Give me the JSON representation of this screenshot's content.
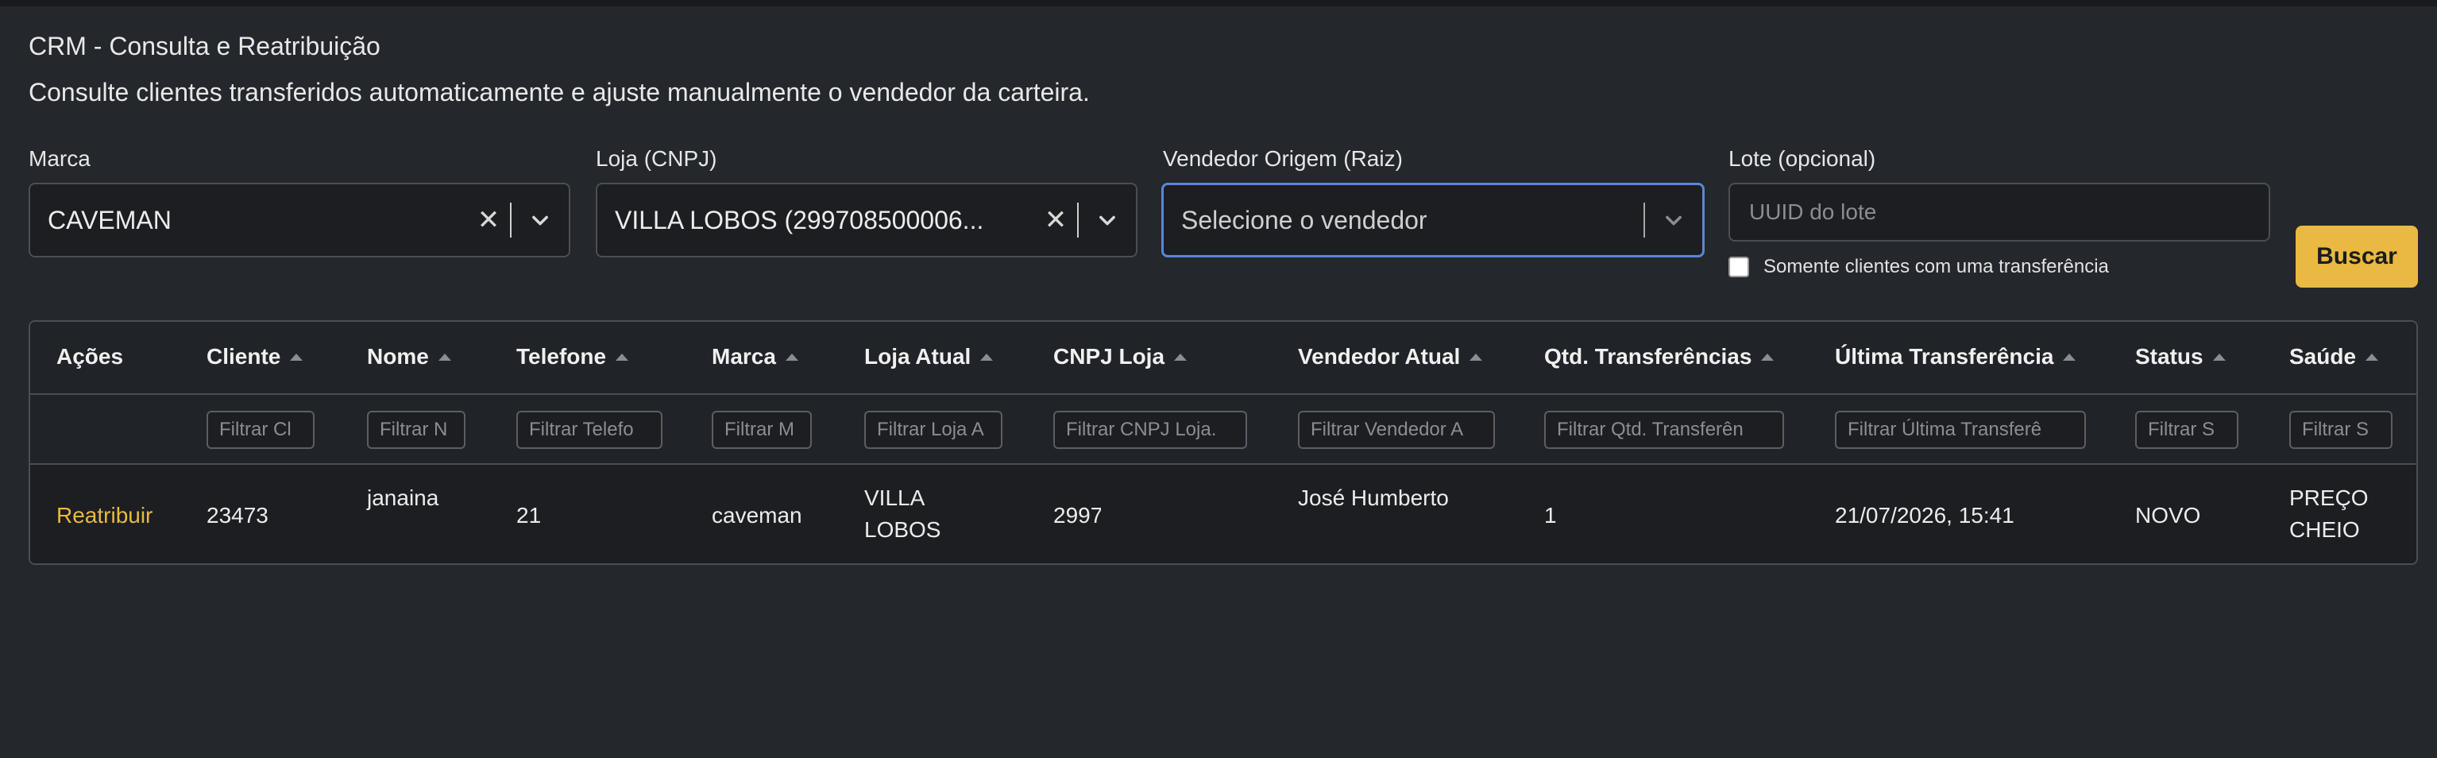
{
  "page": {
    "title": "CRM - Consulta e Reatribuição",
    "subtitle": "Consulte clientes transferidos automaticamente e ajuste manualmente o vendedor da carteira."
  },
  "filters": {
    "marca": {
      "label": "Marca",
      "value": "CAVEMAN"
    },
    "loja": {
      "label": "Loja (CNPJ)",
      "value": "VILLA LOBOS (299708500006..."
    },
    "vendedor": {
      "label": "Vendedor Origem (Raiz)",
      "placeholder": "Selecione o vendedor"
    },
    "lote": {
      "label": "Lote (opcional)",
      "placeholder": "UUID do lote"
    },
    "somente_uma": {
      "label": "Somente clientes com uma transferência",
      "checked": false
    },
    "buscar_label": "Buscar"
  },
  "table": {
    "headers": {
      "acoes": "Ações",
      "cliente": "Cliente",
      "nome": "Nome",
      "telefone": "Telefone",
      "marca": "Marca",
      "loja_atual": "Loja Atual",
      "cnpj_loja": "CNPJ Loja",
      "vendedor_atual": "Vendedor Atual",
      "qtd_transferencias": "Qtd. Transferências",
      "ultima_transferencia": "Última Transferência",
      "status": "Status",
      "saude": "Saúde"
    },
    "filter_placeholders": {
      "cliente": "Filtrar Cl",
      "nome": "Filtrar N",
      "telefone": "Filtrar Telefo",
      "marca": "Filtrar M",
      "loja_atual": "Filtrar Loja A",
      "cnpj_loja": "Filtrar CNPJ Loja.",
      "vendedor_atual": "Filtrar Vendedor A",
      "qtd_transferencias": "Filtrar Qtd. Transferên",
      "ultima_transferencia": "Filtrar Última Transferê",
      "status": "Filtrar S",
      "saude": "Filtrar S"
    },
    "rows": [
      {
        "acao": "Reatribuir",
        "cliente": "23473",
        "nome": "janaina",
        "telefone": "21",
        "marca": "caveman",
        "loja_atual_l1": "VILLA",
        "loja_atual_l2": "LOBOS",
        "cnpj_loja": "2997",
        "vendedor_atual": "José Humberto",
        "qtd_transferencias": "1",
        "ultima_transferencia": "21/07/2026, 15:41",
        "status": "NOVO",
        "saude_l1": "PREÇO",
        "saude_l2": "CHEIO"
      }
    ]
  },
  "colors": {
    "background": "#24272c",
    "accent": "#e9b941",
    "focus_border": "#5b86d6"
  }
}
